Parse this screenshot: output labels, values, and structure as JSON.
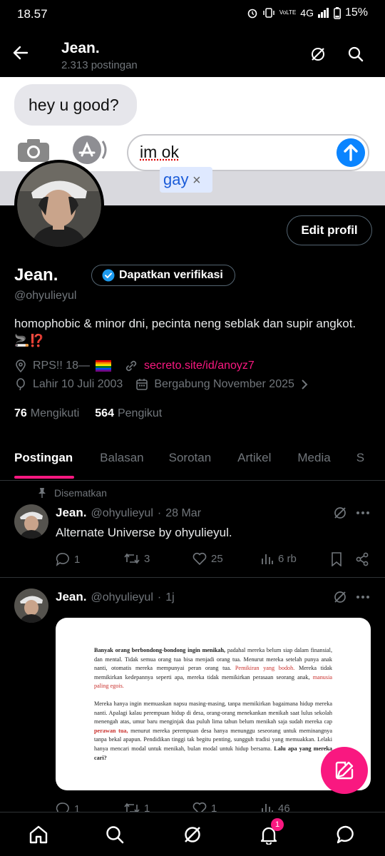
{
  "status_bar": {
    "time": "18.57",
    "battery": "15%",
    "network": "4G"
  },
  "header": {
    "title": "Jean.",
    "post_count": "2.313 postingan"
  },
  "banner": {
    "bubble_text": "hey u good?",
    "message_text": "im ok",
    "autocorrect_suggestion": "gay",
    "autocorrect_dismiss": "×"
  },
  "profile": {
    "edit_button": "Edit profil",
    "name": "Jean.",
    "verify_button": "Dapatkan verifikasi",
    "handle": "@ohyulieyul",
    "bio": "homophobic & minor dni, pecinta neng seblak dan supir angkot. 🚬⁉️",
    "location": "RPS!! 18—",
    "link": "secreto.site/id/anoyz7",
    "birthday": "Lahir 10 Juli 2003",
    "joined": "Bergabung November 2025",
    "following_count": "76",
    "following_label": "Mengikuti",
    "followers_count": "564",
    "followers_label": "Pengikut"
  },
  "tabs": [
    "Postingan",
    "Balasan",
    "Sorotan",
    "Artikel",
    "Media",
    "S"
  ],
  "active_tab": "Postingan",
  "posts": [
    {
      "pinned_label": "Disematkan",
      "name": "Jean.",
      "handle": "@ohyulieyul",
      "sep": "·",
      "time": "28 Mar",
      "text": "Alternate Universe by ohyulieyul.",
      "replies": "1",
      "reposts": "3",
      "likes": "25",
      "views": "6 rb"
    },
    {
      "name": "Jean.",
      "handle": "@ohyulieyul",
      "sep": "·",
      "time": "1j",
      "replies": "1",
      "reposts": "1",
      "likes": "1",
      "views": "46",
      "image_doc": {
        "p1_bold": "Banyak orang berbondong-bondong ingin menikah,",
        "p1_a": " padahal mereka belum siap dalam finansial, dan mental. Tidak semua orang tua bisa menjadi orang tua. Menurut mereka setelah punya anak nanti, otomatis mereka mempunyai peran orang tua. ",
        "p1_red1": "Pemikiran yang bodoh.",
        "p1_b": " Mereka tidak memikirkan kedepannya seperti apa, mereka tidak memikirkan perasaan seorang anak, ",
        "p1_red2": "manusia paling egois.",
        "p2_a": "Mereka hanya ingin memuaskan napsu masing-masing, tanpa memikirkan bagaimana hidup mereka nanti. Apalagi kalau perempuan hidup di desa, orang-orang menekankan menikah saat lulus sekolah menengah atas, umur baru menginjak dua puluh lima tahun belum menikah saja sudah mereka cap ",
        "p2_red": "perawan tua,",
        "p2_b": " menurut mereka perempuan desa hanya menunggu seseorang untuk meminangnya tanpa bekal apapun. Pendidikan tinggi tak begitu penting, sungguh tradisi yang memuakkan. Lelaki hanya mencari modal untuk menikah, bulan modal untuk hidup bersama. ",
        "p2_bold": "Lalu apa yang mereka cari?"
      }
    }
  ],
  "nav": {
    "notification_badge": "1"
  },
  "colors": {
    "accent": "#f91880",
    "verified": "#1d9bf0",
    "muted": "#71767b"
  }
}
